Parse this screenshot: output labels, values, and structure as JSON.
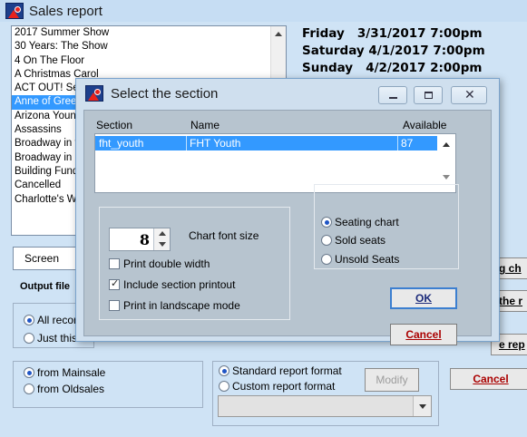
{
  "main_window": {
    "title": "Sales report",
    "shows": [
      "2017 Summer Show",
      "30 Years: The Show",
      "4 On The Floor",
      "A Christmas Carol",
      "ACT OUT! Series",
      "Anne of Green Gables",
      "Arizona Young Artists",
      "Assassins",
      "Broadway in the Park",
      "Broadway in Concert",
      "Building Fund",
      "Cancelled",
      "Charlotte's Web"
    ],
    "selected_show_index": 5,
    "performances": [
      "Friday   3/31/2017 7:00pm",
      "Saturday 4/1/2017 7:00pm",
      "Sunday   4/2/2017 2:00pm"
    ],
    "output_select": "Screen",
    "output_label": "Output file",
    "record_radios": [
      "All records",
      "Just this"
    ],
    "source_radios": [
      "from Mainsale",
      "from Oldsales"
    ],
    "format_radios": [
      "Standard report format",
      "Custom report format"
    ],
    "modify_button": "Modify",
    "cancel_button": "Cancel",
    "right_btn_1": "g ch",
    "right_btn_2": "the r",
    "right_btn_3": "e rep"
  },
  "dialog": {
    "title": "Select the section",
    "columns": [
      "Section",
      "Name",
      "Available"
    ],
    "sections": [
      {
        "section": "fht_youth",
        "name": "FHT Youth",
        "available": "87"
      }
    ],
    "font_size_value": "8",
    "font_size_label": "Chart font size",
    "print_double_width": "Print double width",
    "include_section_printout": "Include section printout",
    "print_landscape": "Print in landscape mode",
    "chart_options": [
      "Seating chart",
      "Sold seats",
      "Unsold Seats"
    ],
    "ok_label": "OK",
    "cancel_label": "Cancel"
  }
}
